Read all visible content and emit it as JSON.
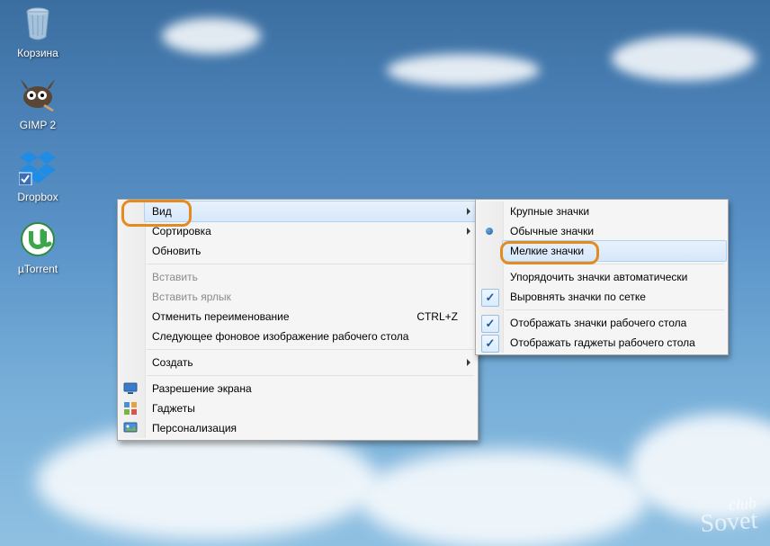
{
  "desktop_icons": [
    {
      "name": "recycle-bin",
      "label": "Корзина"
    },
    {
      "name": "gimp",
      "label": "GIMP 2"
    },
    {
      "name": "dropbox",
      "label": "Dropbox"
    },
    {
      "name": "utorrent",
      "label": "µTorrent"
    }
  ],
  "menu": {
    "view": "Вид",
    "sort": "Сортировка",
    "refresh": "Обновить",
    "paste": "Вставить",
    "paste_shortcut": "Вставить ярлык",
    "undo_rename": "Отменить переименование",
    "undo_rename_key": "CTRL+Z",
    "next_wallpaper": "Следующее фоновое изображение рабочего стола",
    "create": "Создать",
    "resolution": "Разрешение экрана",
    "gadgets": "Гаджеты",
    "personalize": "Персонализация"
  },
  "submenu": {
    "large_icons": "Крупные значки",
    "medium_icons": "Обычные значки",
    "small_icons": "Мелкие значки",
    "auto_arrange": "Упорядочить значки автоматически",
    "align_grid": "Выровнять значки по сетке",
    "show_icons": "Отображать значки рабочего стола",
    "show_gadgets": "Отображать гаджеты  рабочего стола"
  },
  "watermark": {
    "line1": "club",
    "line2": "Sovet"
  }
}
